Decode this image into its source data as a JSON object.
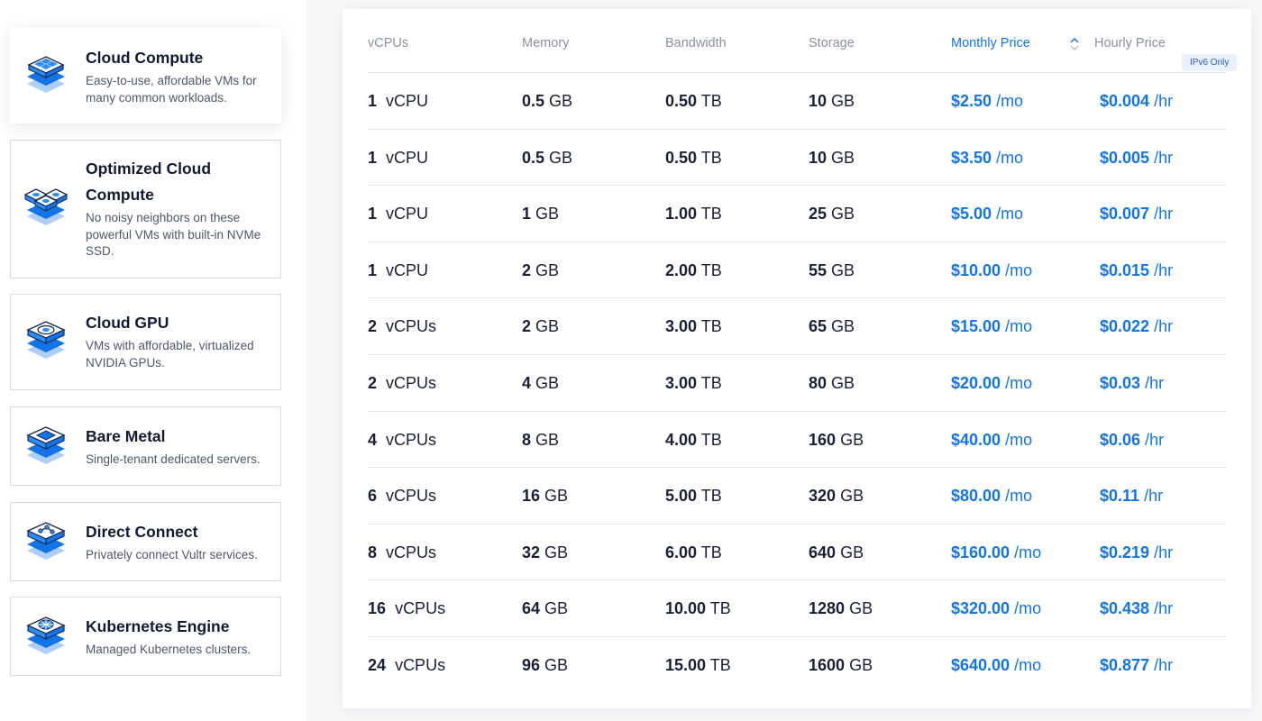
{
  "sidebar": {
    "products": [
      {
        "title": "Cloud Compute",
        "description": "Easy-to-use, affordable VMs for many common workloads.",
        "icon": "cloud-compute-icon"
      },
      {
        "title": "Optimized Cloud Compute",
        "description": "No noisy neighbors on these powerful VMs with built-in NVMe SSD.",
        "icon": "optimized-cloud-compute-icon"
      },
      {
        "title": "Cloud GPU",
        "description": "VMs with affordable, virtualized NVIDIA GPUs.",
        "icon": "cloud-gpu-icon"
      },
      {
        "title": "Bare Metal",
        "description": "Single-tenant dedicated servers.",
        "icon": "bare-metal-icon"
      },
      {
        "title": "Direct Connect",
        "description": "Privately connect Vultr services.",
        "icon": "direct-connect-icon"
      },
      {
        "title": "Kubernetes Engine",
        "description": "Managed Kubernetes clusters.",
        "icon": "kubernetes-engine-icon"
      }
    ]
  },
  "table": {
    "headers": [
      "vCPUs",
      "Memory",
      "Bandwidth",
      "Storage",
      "Monthly Price",
      "Hourly Price"
    ],
    "sorted_column": "Monthly Price",
    "badge": "IPv6 Only",
    "rows": [
      {
        "vcpu": "1",
        "vcpu_unit": "vCPU",
        "mem": "0.5",
        "mem_unit": "GB",
        "bw": "0.50",
        "bw_unit": "TB",
        "storage": "10",
        "storage_unit": "GB",
        "monthly": "$2.50",
        "monthly_unit": "/mo",
        "hourly": "$0.004",
        "hourly_unit": "/hr"
      },
      {
        "vcpu": "1",
        "vcpu_unit": "vCPU",
        "mem": "0.5",
        "mem_unit": "GB",
        "bw": "0.50",
        "bw_unit": "TB",
        "storage": "10",
        "storage_unit": "GB",
        "monthly": "$3.50",
        "monthly_unit": "/mo",
        "hourly": "$0.005",
        "hourly_unit": "/hr"
      },
      {
        "vcpu": "1",
        "vcpu_unit": "vCPU",
        "mem": "1",
        "mem_unit": "GB",
        "bw": "1.00",
        "bw_unit": "TB",
        "storage": "25",
        "storage_unit": "GB",
        "monthly": "$5.00",
        "monthly_unit": "/mo",
        "hourly": "$0.007",
        "hourly_unit": "/hr"
      },
      {
        "vcpu": "1",
        "vcpu_unit": "vCPU",
        "mem": "2",
        "mem_unit": "GB",
        "bw": "2.00",
        "bw_unit": "TB",
        "storage": "55",
        "storage_unit": "GB",
        "monthly": "$10.00",
        "monthly_unit": "/mo",
        "hourly": "$0.015",
        "hourly_unit": "/hr"
      },
      {
        "vcpu": "2",
        "vcpu_unit": "vCPUs",
        "mem": "2",
        "mem_unit": "GB",
        "bw": "3.00",
        "bw_unit": "TB",
        "storage": "65",
        "storage_unit": "GB",
        "monthly": "$15.00",
        "monthly_unit": "/mo",
        "hourly": "$0.022",
        "hourly_unit": "/hr"
      },
      {
        "vcpu": "2",
        "vcpu_unit": "vCPUs",
        "mem": "4",
        "mem_unit": "GB",
        "bw": "3.00",
        "bw_unit": "TB",
        "storage": "80",
        "storage_unit": "GB",
        "monthly": "$20.00",
        "monthly_unit": "/mo",
        "hourly": "$0.03",
        "hourly_unit": "/hr"
      },
      {
        "vcpu": "4",
        "vcpu_unit": "vCPUs",
        "mem": "8",
        "mem_unit": "GB",
        "bw": "4.00",
        "bw_unit": "TB",
        "storage": "160",
        "storage_unit": "GB",
        "monthly": "$40.00",
        "monthly_unit": "/mo",
        "hourly": "$0.06",
        "hourly_unit": "/hr"
      },
      {
        "vcpu": "6",
        "vcpu_unit": "vCPUs",
        "mem": "16",
        "mem_unit": "GB",
        "bw": "5.00",
        "bw_unit": "TB",
        "storage": "320",
        "storage_unit": "GB",
        "monthly": "$80.00",
        "monthly_unit": "/mo",
        "hourly": "$0.11",
        "hourly_unit": "/hr"
      },
      {
        "vcpu": "8",
        "vcpu_unit": "vCPUs",
        "mem": "32",
        "mem_unit": "GB",
        "bw": "6.00",
        "bw_unit": "TB",
        "storage": "640",
        "storage_unit": "GB",
        "monthly": "$160.00",
        "monthly_unit": "/mo",
        "hourly": "$0.219",
        "hourly_unit": "/hr"
      },
      {
        "vcpu": "16",
        "vcpu_unit": "vCPUs",
        "mem": "64",
        "mem_unit": "GB",
        "bw": "10.00",
        "bw_unit": "TB",
        "storage": "1280",
        "storage_unit": "GB",
        "monthly": "$320.00",
        "monthly_unit": "/mo",
        "hourly": "$0.438",
        "hourly_unit": "/hr"
      },
      {
        "vcpu": "24",
        "vcpu_unit": "vCPUs",
        "mem": "96",
        "mem_unit": "GB",
        "bw": "15.00",
        "bw_unit": "TB",
        "storage": "1600",
        "storage_unit": "GB",
        "monthly": "$640.00",
        "monthly_unit": "/mo",
        "hourly": "$0.877",
        "hourly_unit": "/hr"
      }
    ]
  },
  "colors": {
    "accent": "#1374e8",
    "text": "#1a1f36",
    "muted": "#8a91a0",
    "border": "#e4e7ec"
  }
}
